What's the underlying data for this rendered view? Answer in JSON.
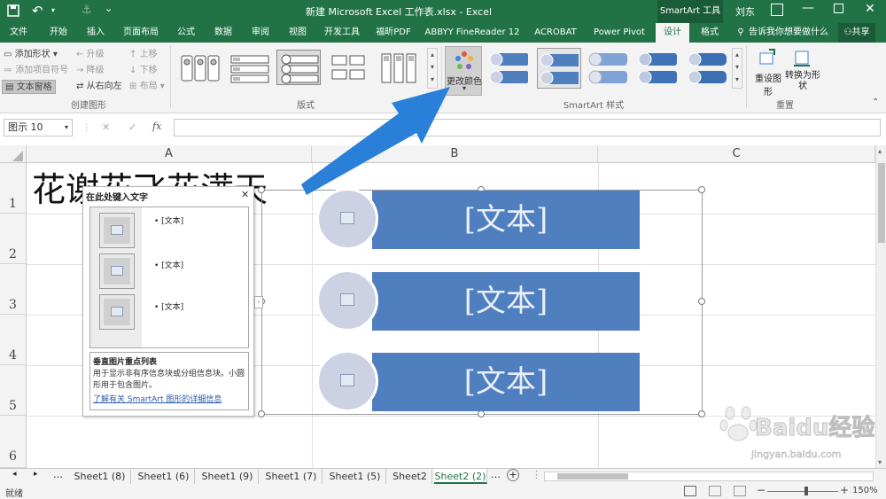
{
  "titlebar": {
    "title": "新建 Microsoft Excel 工作表.xlsx  -  Excel",
    "context_tab": "SmartArt 工具",
    "user": "刘东",
    "save_icon": "save-icon",
    "undo_icon": "undo-icon",
    "redo_icon": "redo-icon"
  },
  "tabs": [
    "文件",
    "开始",
    "插入",
    "页面布局",
    "公式",
    "数据",
    "审阅",
    "视图",
    "开发工具",
    "福昕PDF",
    "ABBYY FineReader 12",
    "ACROBAT",
    "Power Pivot",
    "设计",
    "格式"
  ],
  "active_tab": "设计",
  "tell_me": "告诉我你想要做什么",
  "share": "共享",
  "ribbon": {
    "create_graphic": {
      "add_shape": "添加形状",
      "add_bullet": "添加项目符号",
      "text_pane": "文本窗格",
      "promote": "升级",
      "demote": "降级",
      "right_to_left": "从右向左",
      "move_up": "上移",
      "move_down": "下移",
      "layout": "布局",
      "label": "创建图形"
    },
    "layouts": {
      "label": "版式"
    },
    "change_colors": "更改颜色",
    "styles": {
      "label": "SmartArt 样式"
    },
    "reset": {
      "reset_graphic": "重设图形",
      "convert_to_shape": "转换为形状",
      "label": "重置"
    }
  },
  "formulabar": {
    "namebox": "图示 10",
    "fx": "fx",
    "cancel": "✕",
    "enter": "✓",
    "value": ""
  },
  "grid": {
    "columns": [
      "A",
      "B",
      "C"
    ],
    "rows": [
      "1",
      "2",
      "3",
      "4",
      "5",
      "6"
    ],
    "cell_a1": "花谢花飞花满天"
  },
  "smartart": {
    "items": [
      "[文本]",
      "[文本]",
      "[文本]"
    ]
  },
  "textpane": {
    "title": "在此处键入文字",
    "bullets": [
      "[文本]",
      "[文本]",
      "[文本]"
    ],
    "desc_title": "垂直图片重点列表",
    "desc_body": "用于显示非有序信息块或分组信息块。小圆形用于包含图片。",
    "link": "了解有关 SmartArt 图形的详细信息"
  },
  "sheets": [
    "Sheet1 (8)",
    "Sheet1 (6)",
    "Sheet1 (9)",
    "Sheet1 (7)",
    "Sheet1 (5)",
    "Sheet2",
    "Sheet2 (2)"
  ],
  "active_sheet": "Sheet2 (2)",
  "status": {
    "left": "就绪",
    "zoom": "150%"
  },
  "watermark": "Baidu经验",
  "watermark_url": "jingyan.baidu.com",
  "colors": {
    "excel_green": "#217346",
    "smartart_blue": "#4f7fbf",
    "circle_fill": "#ccd2e3",
    "arrow_blue": "#2a7fd8"
  }
}
